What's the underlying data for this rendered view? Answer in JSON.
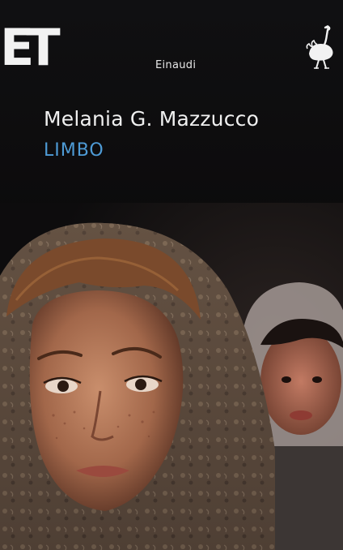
{
  "cover": {
    "series_logo": "ET",
    "publisher": "Einaudi",
    "author": "Melania G. Mazzucco",
    "title": "LIMBO"
  },
  "colors": {
    "background": "#0d0c0d",
    "title_blue": "#4e9bd6",
    "text_white": "#f0f0f0"
  },
  "icons": {
    "publisher_emblem": "ostrich-icon"
  }
}
